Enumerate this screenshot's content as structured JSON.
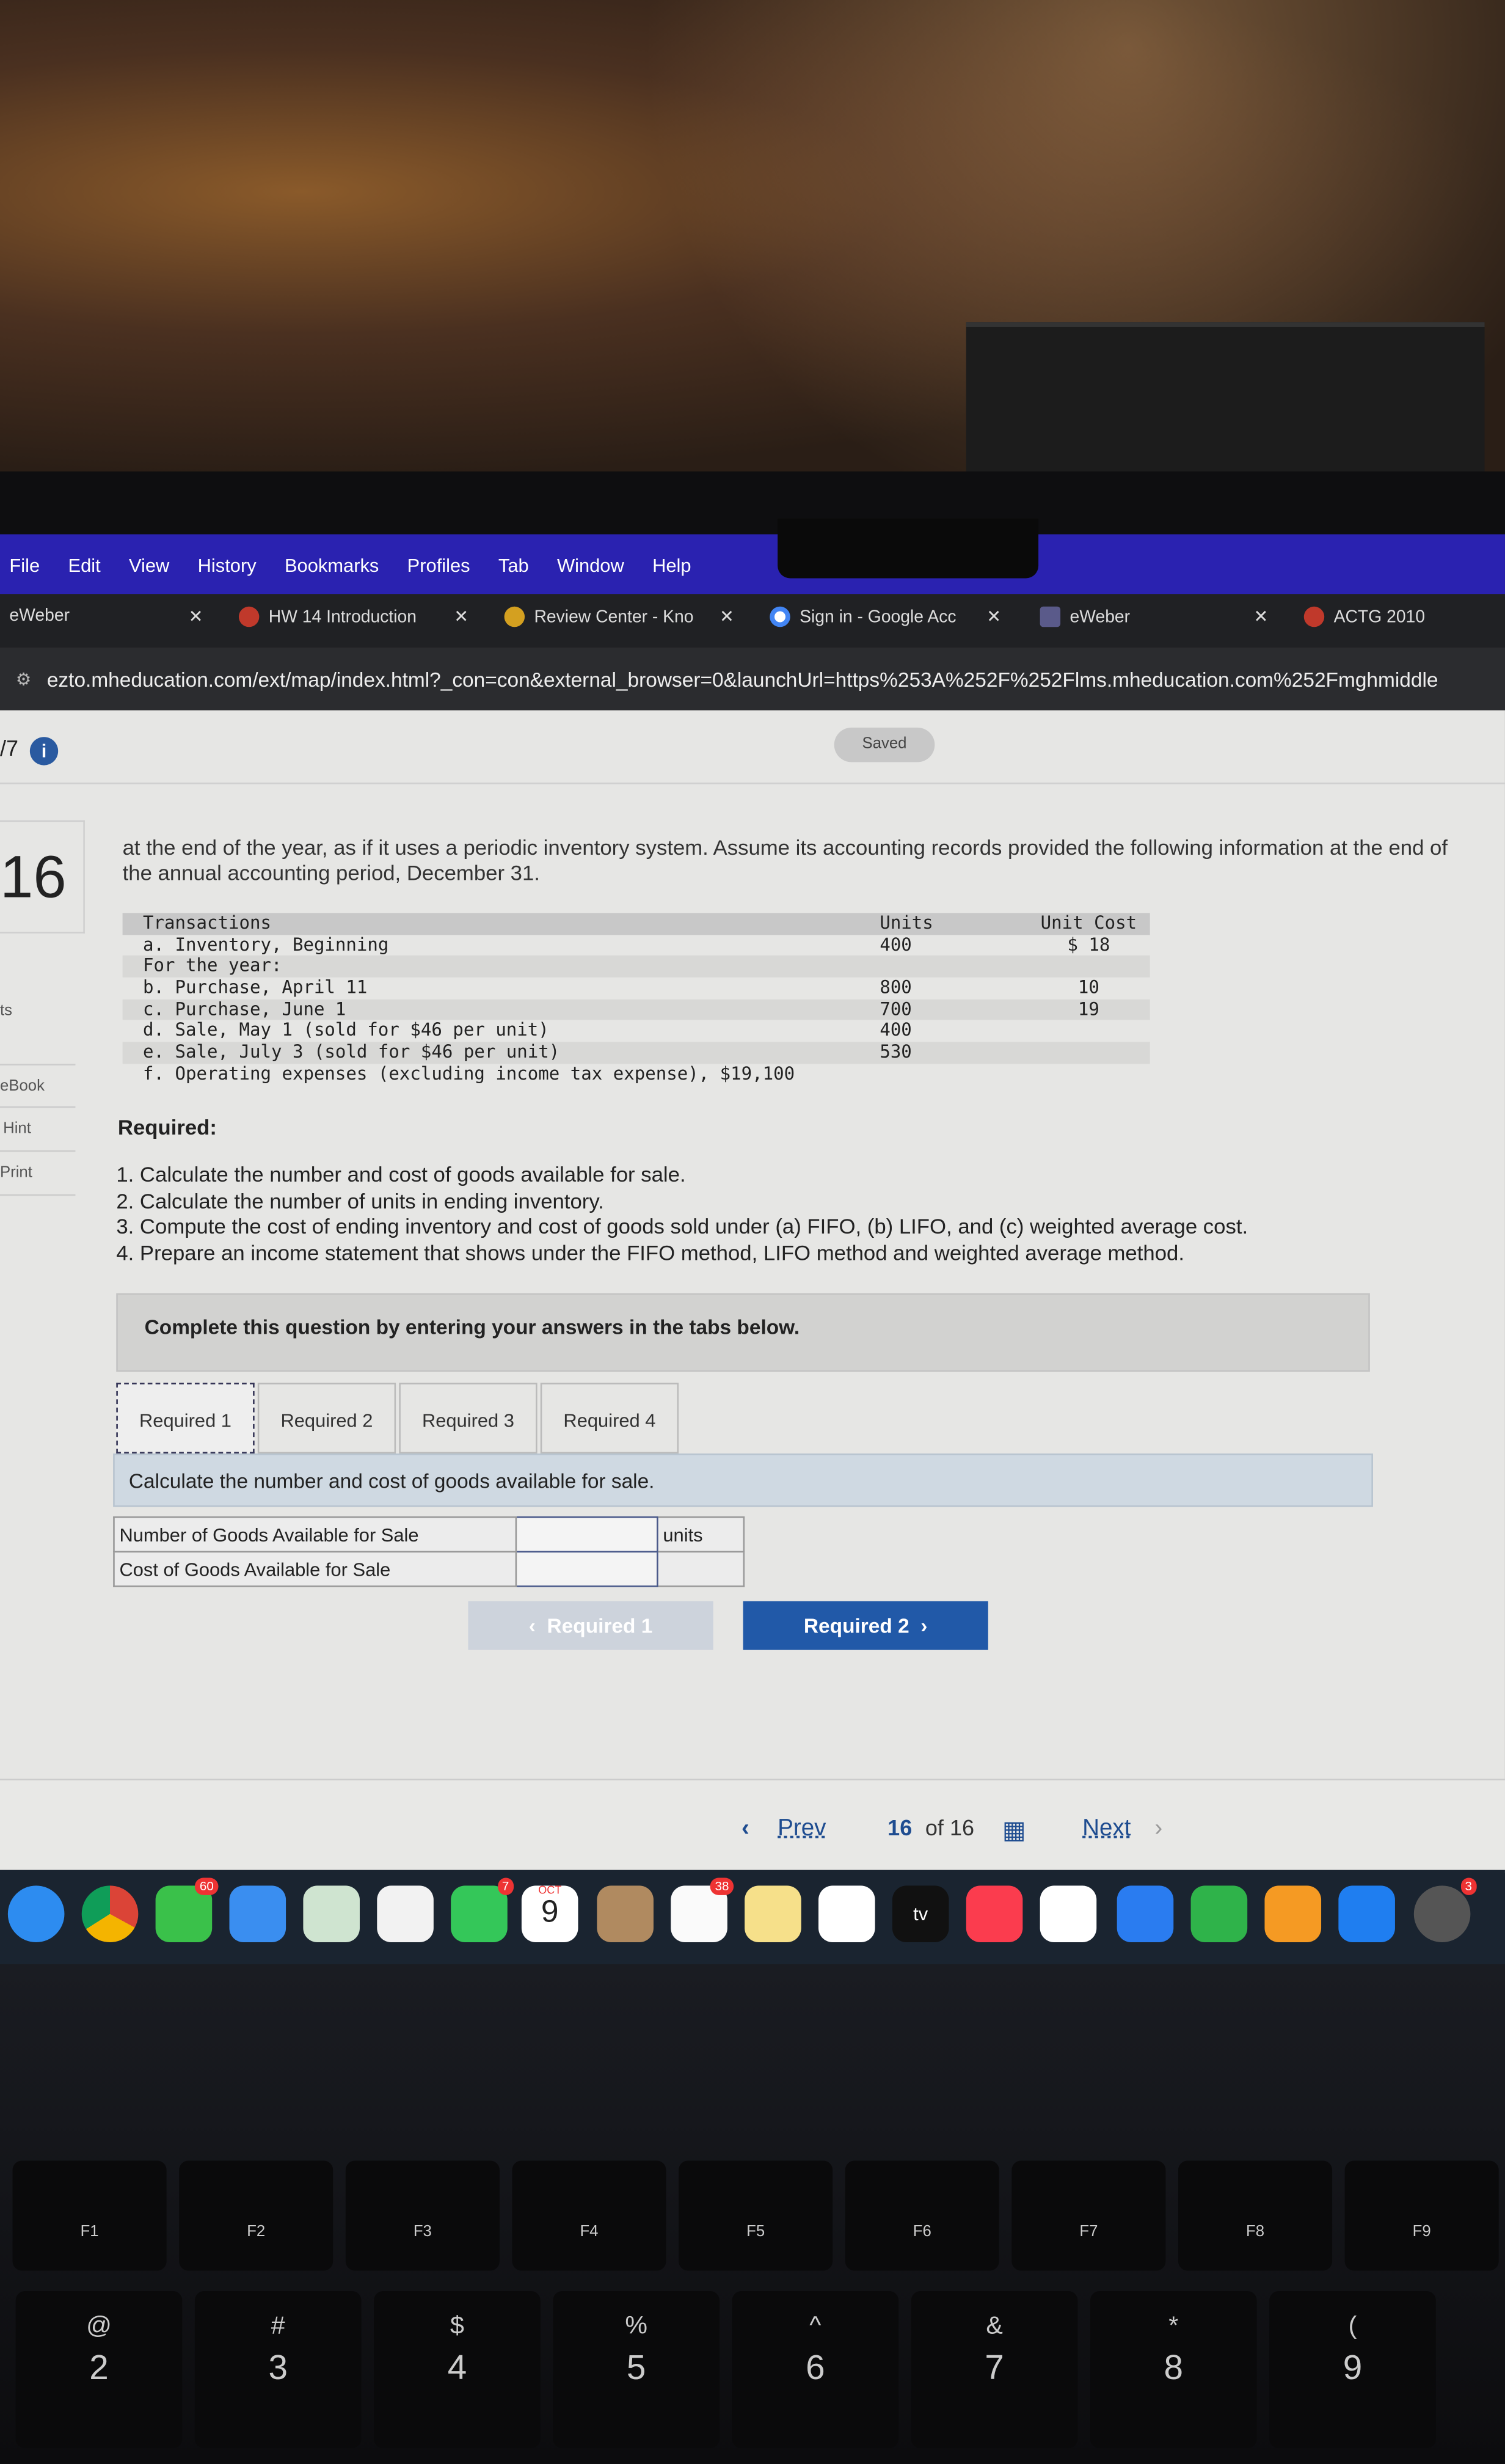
{
  "menu": [
    "File",
    "Edit",
    "View",
    "History",
    "Bookmarks",
    "Profiles",
    "Tab",
    "Window",
    "Help"
  ],
  "tabs": [
    {
      "title": "eWeber"
    },
    {
      "title": "HW 14 Introduction"
    },
    {
      "title": "Review Center - Kno"
    },
    {
      "title": "Sign in - Google Acc"
    },
    {
      "title": "eWeber"
    },
    {
      "title": "ACTG 2010"
    }
  ],
  "address": "ezto.mheducation.com/ext/map/index.html?_con=con&external_browser=0&launchUrl=https%253A%252F%252Flms.mheducation.com%252Fmghmiddle",
  "header": {
    "points_partial": "/7",
    "saved": "Saved",
    "question_number": "16"
  },
  "sidebar": [
    "ts",
    "eBook",
    "Hint",
    "Print"
  ],
  "intro": "at the end of the year, as if it uses a periodic inventory system. Assume its accounting records provided the following information at the end of the annual accounting period, December 31.",
  "data_table": {
    "headers": [
      "Transactions",
      "Units",
      "Unit Cost"
    ],
    "rows": [
      [
        "a. Inventory, Beginning",
        "400",
        "$ 18"
      ],
      [
        "For the year:",
        "",
        ""
      ],
      [
        "b. Purchase, April 11",
        "800",
        "10"
      ],
      [
        "c. Purchase, June 1",
        "700",
        "19"
      ],
      [
        "d. Sale, May 1 (sold for $46 per unit)",
        "400",
        ""
      ],
      [
        "e. Sale, July 3 (sold for $46 per unit)",
        "530",
        ""
      ],
      [
        "f. Operating expenses (excluding income tax expense), $19,100",
        "",
        ""
      ]
    ]
  },
  "required_title": "Required:",
  "required": [
    "1. Calculate the number and cost of goods available for sale.",
    "2. Calculate the number of units in ending inventory.",
    "3. Compute the cost of ending inventory and cost of goods sold under (a) FIFO, (b) LIFO, and (c) weighted average cost.",
    "4. Prepare an income statement that shows under the FIFO method, LIFO method and weighted average method."
  ],
  "complete_banner": "Complete this question by entering your answers in the tabs below.",
  "req_tabs": [
    "Required 1",
    "Required 2",
    "Required 3",
    "Required 4"
  ],
  "instruction": "Calculate the number and cost of goods available for sale.",
  "answer_rows": [
    {
      "label": "Number of Goods Available for Sale",
      "value": "",
      "unit": "units"
    },
    {
      "label": "Cost of Goods Available for Sale",
      "value": "",
      "unit": ""
    }
  ],
  "buttons": {
    "prev": "Required 1",
    "next": "Required 2"
  },
  "footer": {
    "prev": "Prev",
    "page": "16",
    "of": "of 16",
    "next": "Next"
  },
  "dock_badges": {
    "messages": "60",
    "facetime": "7",
    "calendar_month": "OCT",
    "calendar_day": "9",
    "reminders": "38",
    "settings": "3"
  },
  "keys": {
    "fn": [
      "F1",
      "F2",
      "F3",
      "F4",
      "F5",
      "F6",
      "F7",
      "F8",
      "F9"
    ],
    "num": [
      [
        "@",
        "2"
      ],
      [
        "#",
        "3"
      ],
      [
        "$",
        "4"
      ],
      [
        "%",
        "5"
      ],
      [
        "^",
        "6"
      ],
      [
        "&",
        "7"
      ],
      [
        "*",
        "8"
      ],
      [
        "(",
        "9"
      ]
    ]
  }
}
